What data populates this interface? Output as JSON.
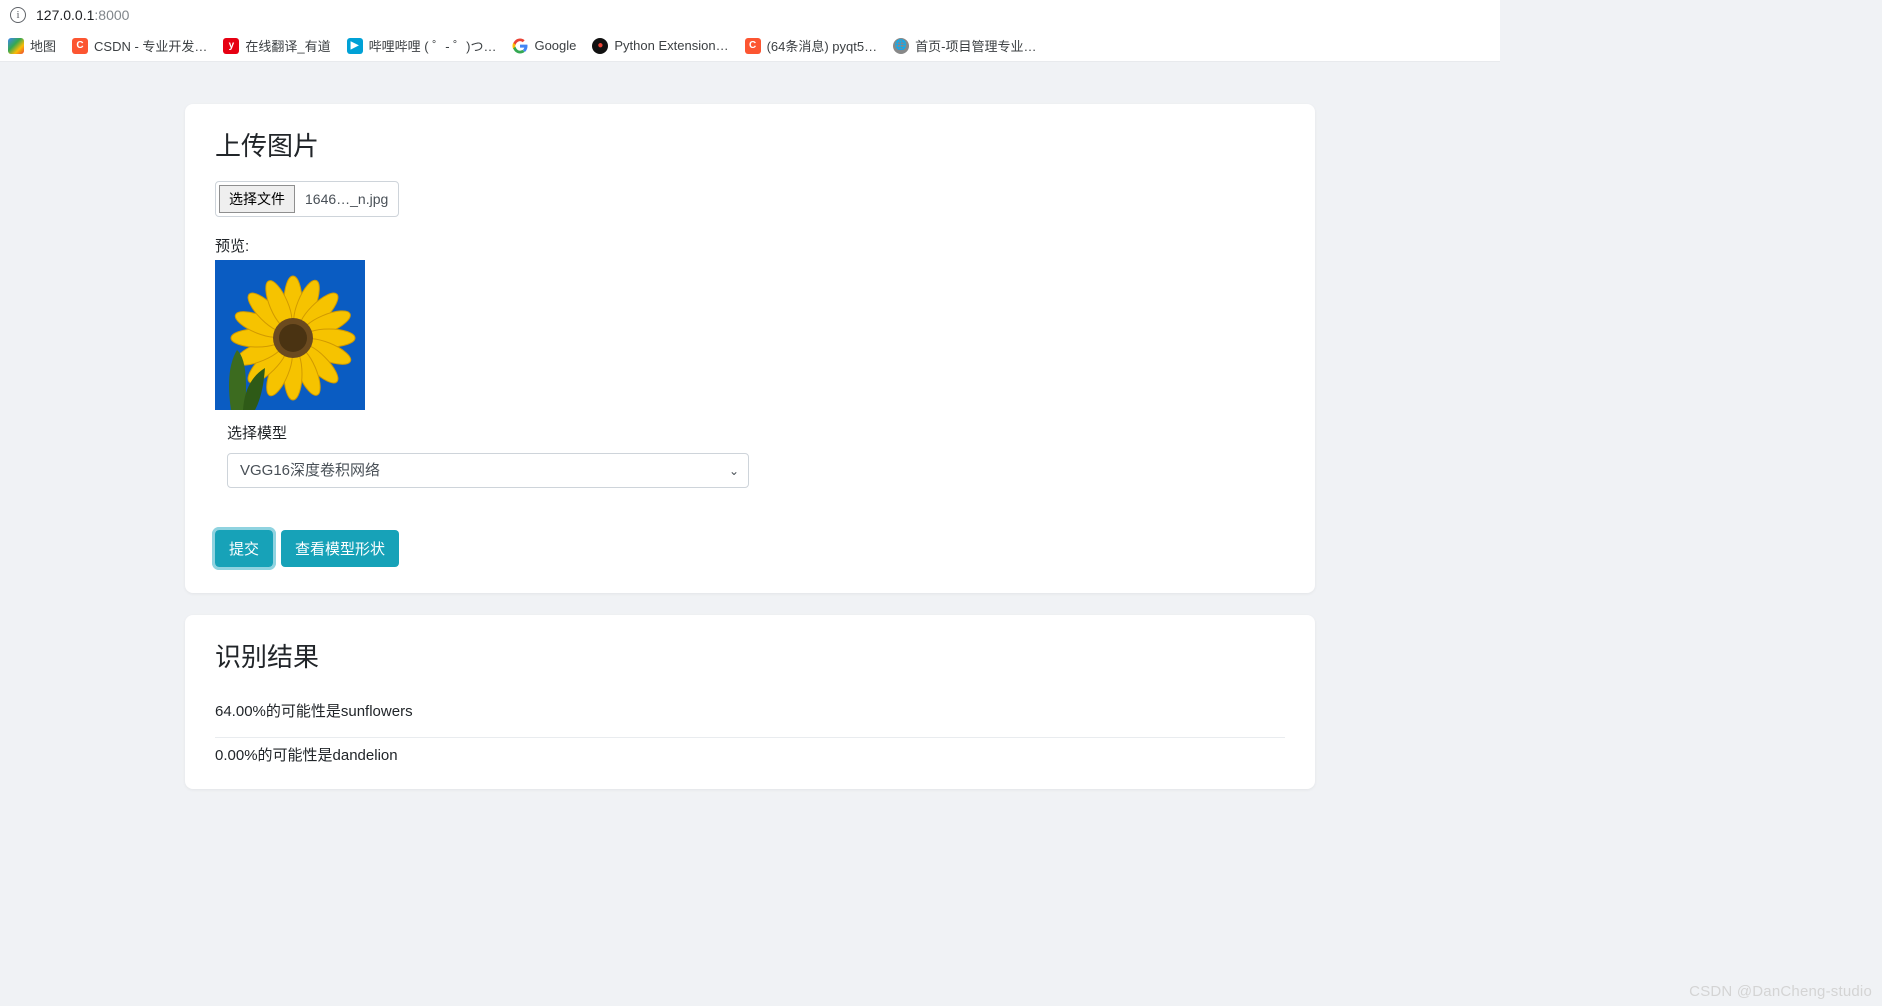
{
  "address": {
    "host": "127.0.0.1",
    "port": ":8000"
  },
  "bookmarks": {
    "maps": "地图",
    "csdn": "CSDN - 专业开发…",
    "youdao": "在线翻译_有道",
    "bilibili": "哔哩哔哩 (  ゜- ゜)つ…",
    "google": "Google",
    "python_ext": "Python Extension…",
    "pyqt": "(64条消息) pyqt5…",
    "pm_home": "首页-项目管理专业…"
  },
  "upload": {
    "title": "上传图片",
    "choose_file_btn": "选择文件",
    "file_name": "1646…_n.jpg",
    "preview_label": "预览:",
    "model_label": "选择模型",
    "model_selected": "VGG16深度卷积网络",
    "submit_btn": "提交",
    "view_shape_btn": "查看模型形状"
  },
  "results": {
    "title": "识别结果",
    "row1": "64.00%的可能性是sunflowers",
    "row2": "0.00%的可能性是dandelion"
  },
  "watermark": "CSDN @DanCheng-studio"
}
